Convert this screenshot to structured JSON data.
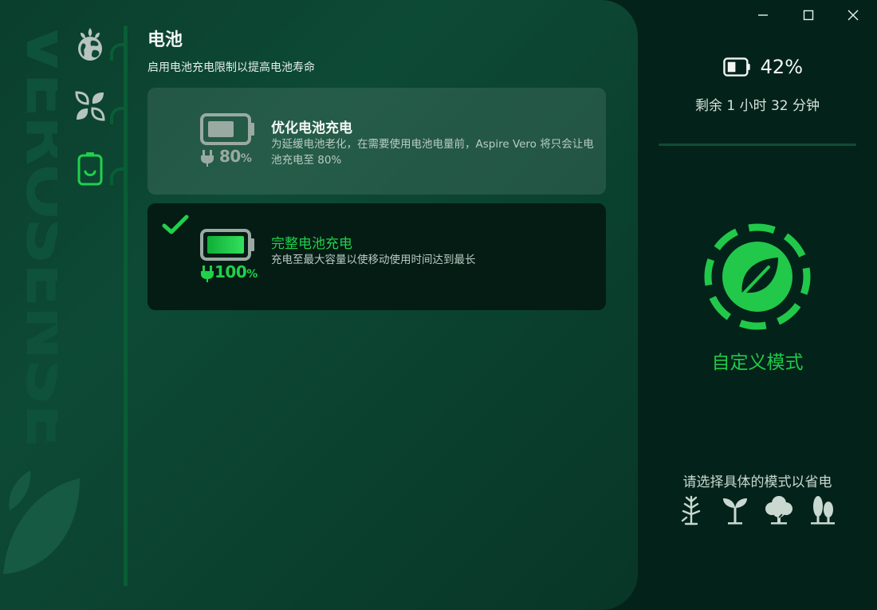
{
  "nav": {
    "items": [
      {
        "name": "globe-nav",
        "icon": "earth-leaf-icon",
        "active": false
      },
      {
        "name": "eco-nav",
        "icon": "leaves-icon",
        "active": false
      },
      {
        "name": "battery-nav",
        "icon": "battery-leaf-icon",
        "active": true
      }
    ]
  },
  "brand": {
    "watermark_text": "VEROSENSE"
  },
  "section": {
    "title": "电池",
    "subtitle": "启用电池充电限制以提高电池寿命"
  },
  "options": [
    {
      "id": "optimized",
      "title": "优化电池充电",
      "description": "为延缓电池老化，在需要使用电池电量前，Aspire Vero 将只会让电池充电至 80%",
      "percent_number": "80",
      "percent_sign": "%",
      "selected": false,
      "color": "#9aaaa3"
    },
    {
      "id": "full",
      "title": "完整电池充电",
      "description": "充电至最大容量以使移动使用时间达到最长",
      "percent_number": "100",
      "percent_sign": "%",
      "selected": true,
      "color": "#21d04b"
    }
  ],
  "window_controls": {
    "minimize": "minimize-icon",
    "maximize": "maximize-icon",
    "close": "close-icon"
  },
  "status": {
    "battery_percent": "42%",
    "battery_level": 0.42,
    "time_remaining": "剩余 1 小时 32 分钟"
  },
  "mode": {
    "label": "自定义模式",
    "prompt": "请选择具体的模式以省电",
    "options": [
      "sprout-icon",
      "seedling-icon",
      "tree-icon",
      "forest-icon"
    ]
  },
  "colors": {
    "accent": "#21c84a",
    "background": "#03231a",
    "panel": "#0d4a35"
  }
}
